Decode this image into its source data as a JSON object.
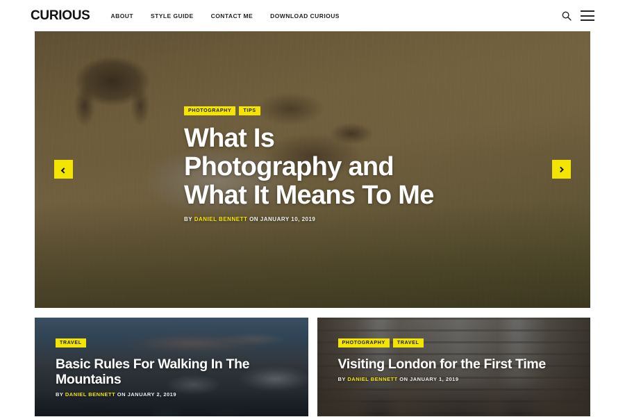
{
  "header": {
    "brand": "CURIOUS",
    "nav": [
      {
        "label": "ABOUT"
      },
      {
        "label": "STYLE GUIDE"
      },
      {
        "label": "CONTACT ME"
      },
      {
        "label": "DOWNLOAD CURIOUS"
      }
    ],
    "search_icon": "search-icon",
    "menu_icon": "hamburger-menu-icon"
  },
  "hero": {
    "tags": [
      "PHOTOGRAPHY",
      "TIPS"
    ],
    "title": "What Is Photography and What It Means To Me",
    "byline_prefix": "BY ",
    "author": "DANIEL BENNETT",
    "byline_suffix": " ON JANUARY 10, 2019",
    "prev_label": "‹",
    "next_label": "›",
    "image_alt": "elk-in-golden-grassland"
  },
  "cards": [
    {
      "tags": [
        "TRAVEL"
      ],
      "title": "Basic Rules For Walking In The Mountains",
      "byline_prefix": "BY ",
      "author": "DANIEL BENNETT",
      "byline_suffix": " ON JANUARY 2, 2019",
      "image_alt": "mountain-lake-at-dusk"
    },
    {
      "tags": [
        "PHOTOGRAPHY",
        "TRAVEL"
      ],
      "title": "Visiting London for the First Time",
      "byline_prefix": "BY ",
      "author": "DANIEL BENNETT",
      "byline_suffix": " ON JANUARY 1, 2019",
      "image_alt": "london-street-buildings"
    }
  ],
  "colors": {
    "accent": "#F3E500",
    "text_dark": "#111111",
    "background": "#FFFFFF",
    "title_white": "#FFFFFF"
  }
}
